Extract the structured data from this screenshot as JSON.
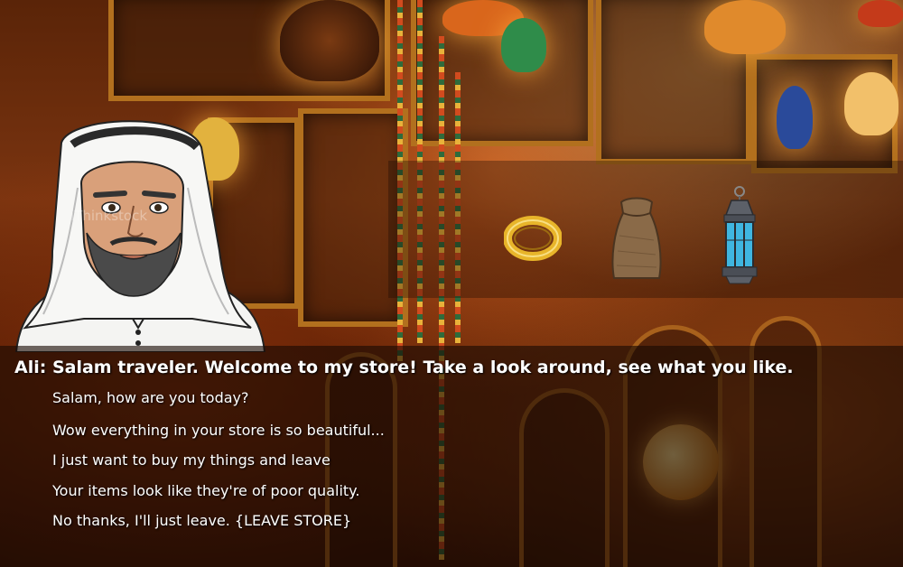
{
  "dialogue": {
    "speaker": "Ali",
    "line": "Ali: Salam traveler. Welcome to my store! Take a look around, see what you like.",
    "choices": [
      "Salam, how are you today?",
      "Wow everything in your store is so beautiful...",
      "I just want to buy my things and leave",
      "Your items look like they're of poor quality.",
      "No thanks, I'll just leave. {LEAVE STORE}"
    ]
  },
  "items": [
    {
      "icon": "gold-ring-icon"
    },
    {
      "icon": "burlap-sack-icon"
    },
    {
      "icon": "lantern-icon"
    }
  ],
  "watermark": "iThinkstock",
  "colors": {
    "text": "#ffffff",
    "panel": "#190a04",
    "gold": "#e8b52a",
    "lantern_glass": "#3fb6e0"
  }
}
